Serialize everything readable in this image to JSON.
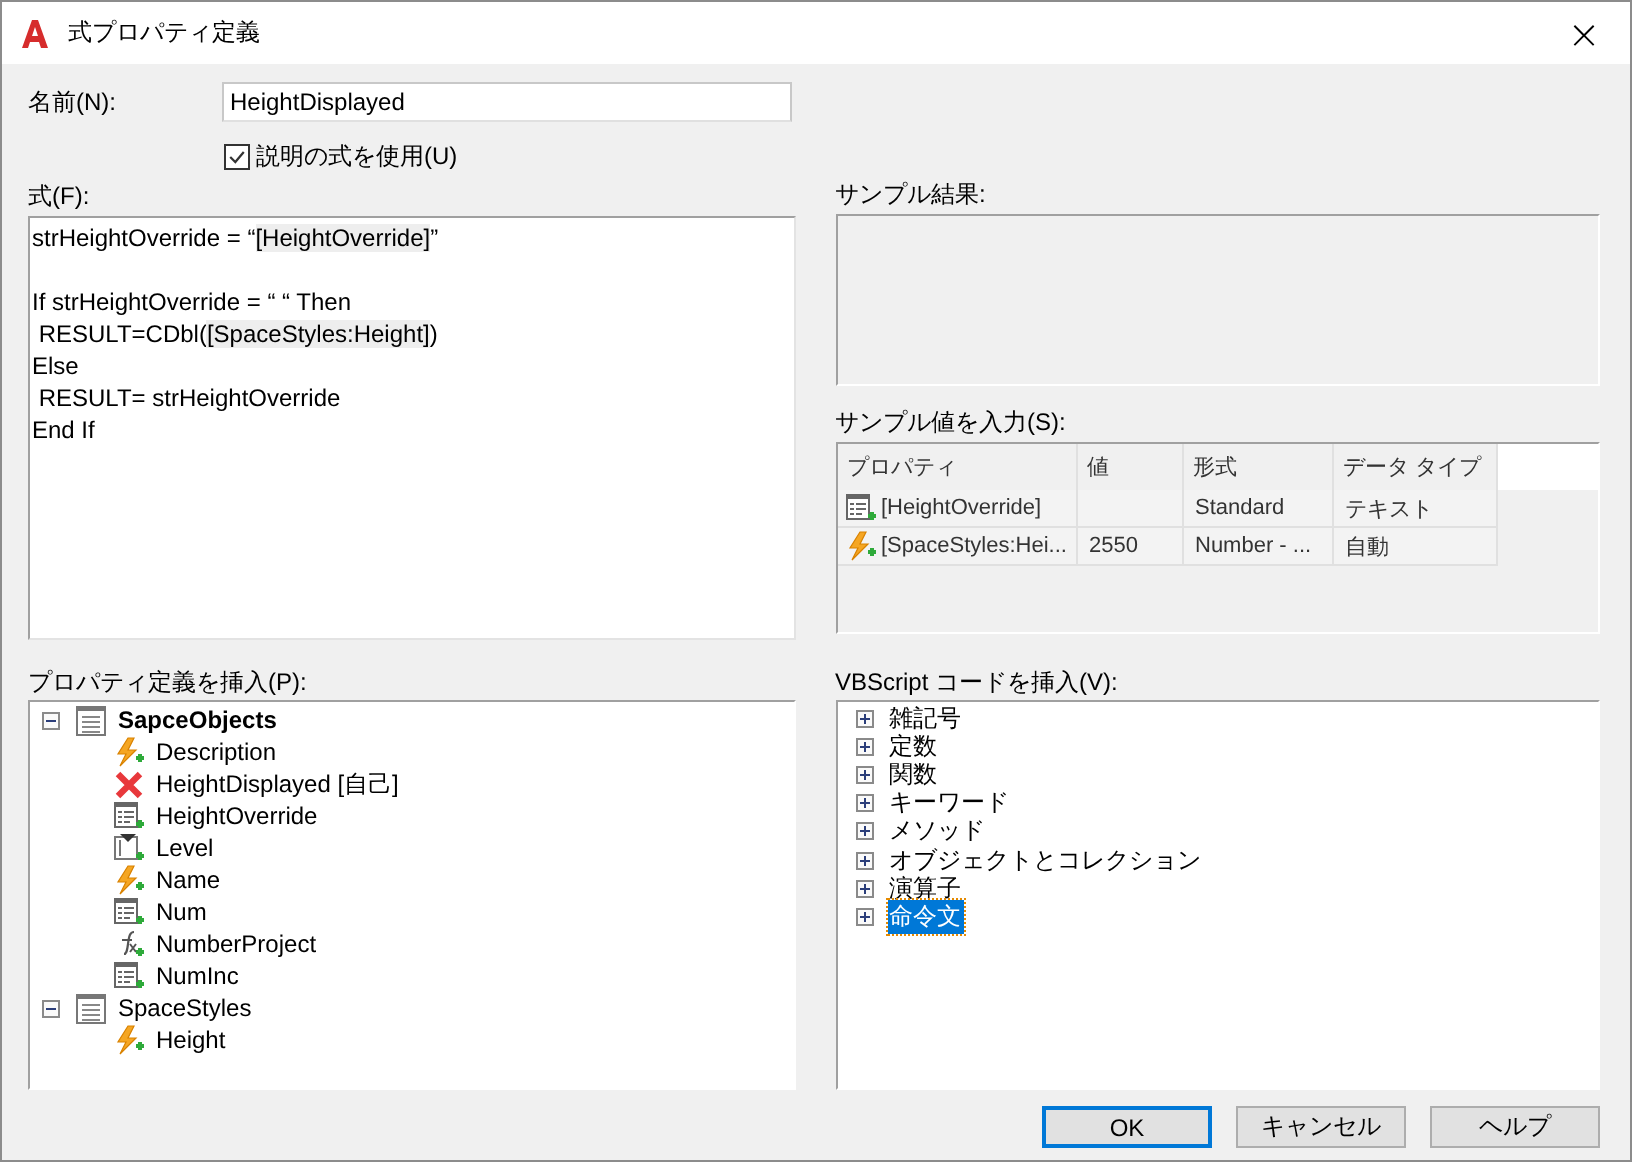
{
  "window": {
    "title": "式プロパティ定義",
    "close": "×"
  },
  "name_field": {
    "label": "名前(N):",
    "value": "HeightDisplayed"
  },
  "use_description": {
    "label": "説明の式を使用(U)",
    "checked": true
  },
  "expression": {
    "label": "式(F):",
    "lines": [
      {
        "parts": [
          {
            "kind": "text",
            "text": "strHeightOverride = “"
          },
          {
            "kind": "field",
            "text": "[HeightOverride]"
          },
          {
            "kind": "text",
            "text": "”"
          }
        ]
      },
      {
        "blank_before": true,
        "parts": [
          {
            "kind": "text",
            "text": "If strHeightOverride = “ “ Then"
          }
        ]
      },
      {
        "parts": [
          {
            "kind": "text",
            "text": " RESULT=CDbl("
          },
          {
            "kind": "field",
            "text": "[SpaceStyles:Height]"
          },
          {
            "kind": "text",
            "text": ")"
          }
        ]
      },
      {
        "parts": [
          {
            "kind": "text",
            "text": "Else"
          }
        ]
      },
      {
        "parts": [
          {
            "kind": "text",
            "text": " RESULT= strHeightOverride"
          }
        ]
      },
      {
        "parts": [
          {
            "kind": "text",
            "text": "End If"
          }
        ]
      }
    ]
  },
  "sample_result": {
    "label": "サンプル結果:"
  },
  "sample_values": {
    "label": "サンプル値を入力(S):",
    "columns": [
      "プロパティ",
      "値",
      "形式",
      "データ タイプ"
    ],
    "rows": [
      {
        "kind": "list",
        "property": "[HeightOverride]",
        "format": "Standard",
        "data_type": "テキスト"
      },
      {
        "kind": "lightning",
        "property": "[SpaceStyles:Hei...",
        "value": "2550",
        "format": "Number - ...",
        "data_type": "自動"
      }
    ]
  },
  "property_tree": {
    "label": "プロパティ定義を挿入(P):",
    "items": [
      {
        "label": "SapceObjects",
        "kind": "table",
        "expanded": true,
        "emphasized": true,
        "children": [
          {
            "label": "Description",
            "kind": "lightning"
          },
          {
            "label": "HeightDisplayed [自己]",
            "kind": "error"
          },
          {
            "label": "HeightOverride",
            "kind": "list"
          },
          {
            "label": "Level",
            "kind": "level"
          },
          {
            "label": "Name",
            "kind": "lightning"
          },
          {
            "label": "Num",
            "kind": "list"
          },
          {
            "label": "NumberProject",
            "kind": "function"
          },
          {
            "label": "NumInc",
            "kind": "list"
          }
        ]
      },
      {
        "label": "SpaceStyles",
        "kind": "table",
        "expanded": true,
        "emphasized": false,
        "children": [
          {
            "label": "Height",
            "kind": "lightning"
          }
        ]
      }
    ]
  },
  "vbscript_tree": {
    "label": "VBScript コードを挿入(V):",
    "items": [
      {
        "label": "雑記号",
        "expanded": false,
        "selected": false
      },
      {
        "label": "定数",
        "expanded": false,
        "selected": false
      },
      {
        "label": "関数",
        "expanded": false,
        "selected": false
      },
      {
        "label": "キーワード",
        "expanded": false,
        "selected": false
      },
      {
        "label": "メソッド",
        "expanded": false,
        "selected": false
      },
      {
        "label": "オブジェクトとコレクション",
        "expanded": false,
        "selected": false
      },
      {
        "label": "演算子",
        "expanded": false,
        "selected": false
      },
      {
        "label": "命令文",
        "expanded": false,
        "selected": true
      }
    ]
  },
  "buttons": [
    {
      "label": "OK",
      "default": true
    },
    {
      "label": "キャンセル",
      "default": false
    },
    {
      "label": "ヘルプ",
      "default": false
    }
  ]
}
